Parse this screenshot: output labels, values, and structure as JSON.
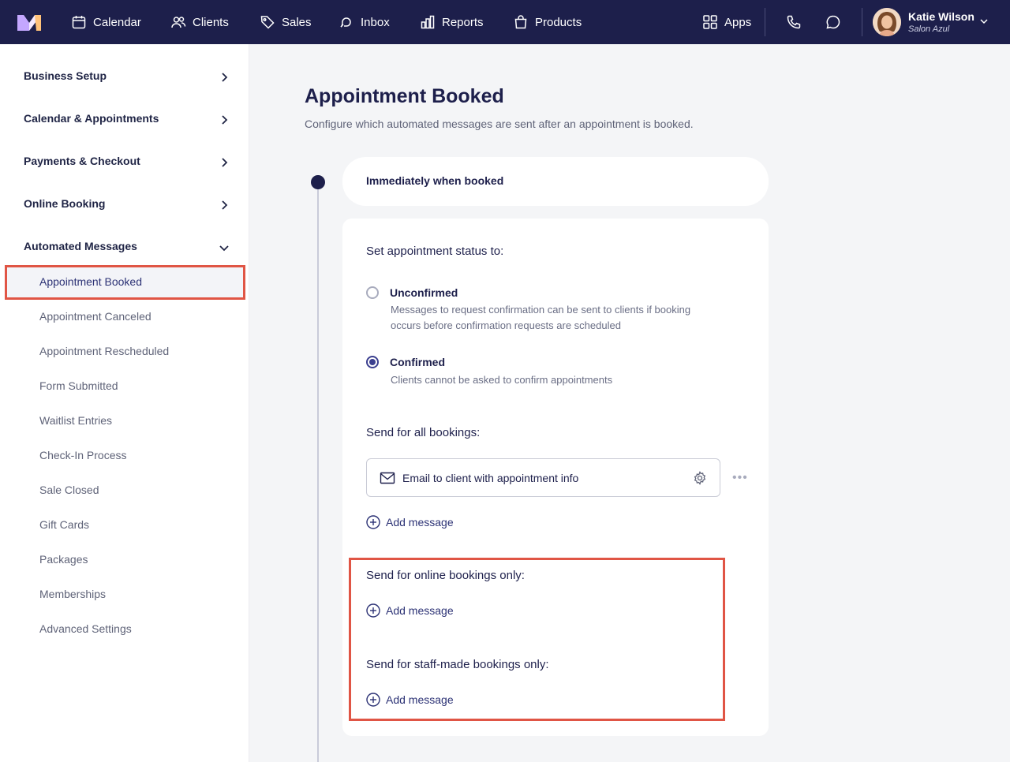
{
  "topbar": {
    "nav": [
      {
        "label": "Calendar",
        "icon": "calendar-icon"
      },
      {
        "label": "Clients",
        "icon": "users-icon"
      },
      {
        "label": "Sales",
        "icon": "tag-icon"
      },
      {
        "label": "Inbox",
        "icon": "inbox-icon"
      },
      {
        "label": "Reports",
        "icon": "chart-icon"
      },
      {
        "label": "Products",
        "icon": "bag-icon"
      }
    ],
    "apps_label": "Apps",
    "user": {
      "name": "Katie Wilson",
      "business": "Salon Azul"
    }
  },
  "sidebar": {
    "sections": [
      {
        "label": "Business Setup",
        "expanded": false
      },
      {
        "label": "Calendar & Appointments",
        "expanded": false
      },
      {
        "label": "Payments & Checkout",
        "expanded": false
      },
      {
        "label": "Online Booking",
        "expanded": false
      },
      {
        "label": "Automated Messages",
        "expanded": true
      }
    ],
    "sub_items": [
      "Appointment Booked",
      "Appointment Canceled",
      "Appointment Rescheduled",
      "Form Submitted",
      "Waitlist Entries",
      "Check-In Process",
      "Sale Closed",
      "Gift Cards",
      "Packages",
      "Memberships",
      "Advanced Settings"
    ],
    "active_sub_item": "Appointment Booked"
  },
  "main": {
    "title": "Appointment Booked",
    "description": "Configure which automated messages are sent after an appointment is booked.",
    "trigger_label": "Immediately when booked",
    "status_heading": "Set appointment status to:",
    "status_options": [
      {
        "label": "Unconfirmed",
        "desc1": "Messages to request confirmation can be sent to clients if booking",
        "desc2": "occurs before confirmation requests are scheduled",
        "selected": false
      },
      {
        "label": "Confirmed",
        "desc1": "Clients cannot be asked to confirm appointments",
        "desc2": "",
        "selected": true
      }
    ],
    "all_bookings_heading": "Send for all bookings:",
    "message_item": "Email to client with appointment info",
    "add_message_label": "Add message",
    "online_heading": "Send for online bookings only:",
    "staff_heading": "Send for staff-made bookings only:"
  },
  "colors": {
    "nav_bg": "#1d1f4b",
    "accent": "#2c3275",
    "highlight": "#e05545"
  }
}
